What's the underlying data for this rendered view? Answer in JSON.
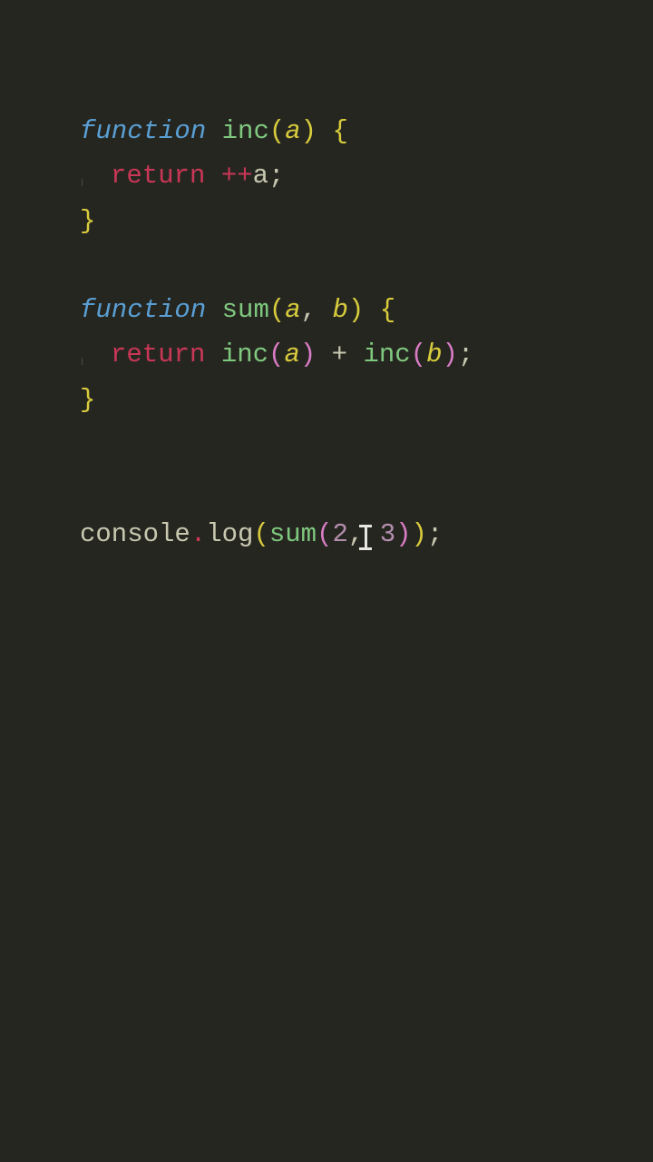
{
  "code": {
    "line1": {
      "kw_function": "function",
      "fn_name": "inc",
      "param_a": "a"
    },
    "line2": {
      "kw_return": "return",
      "op_inc": "++",
      "var_a": "a"
    },
    "line4": {
      "kw_function": "function",
      "fn_name": "sum",
      "param_a": "a",
      "param_b": "b"
    },
    "line5": {
      "kw_return": "return",
      "fn_inc1": "inc",
      "arg_a": "a",
      "fn_inc2": "inc",
      "arg_b": "b"
    },
    "line7": {
      "obj_console": "console",
      "method_log": "log",
      "fn_sum": "sum",
      "arg1": "2",
      "arg2": "3"
    }
  }
}
